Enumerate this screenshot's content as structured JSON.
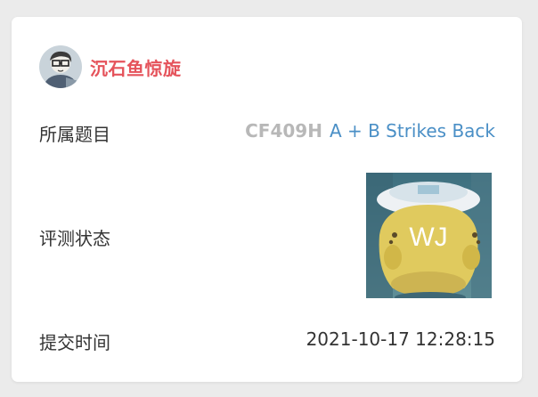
{
  "user": {
    "name": "沉石鱼惊旋"
  },
  "rows": {
    "problem_label": "所属题目",
    "problem_id": "CF409H",
    "problem_title": "A + B Strikes Back",
    "status_label": "评测状态",
    "status_text": "WJ",
    "time_label": "提交时间",
    "time_value": "2021-10-17 12:28:15"
  },
  "colors": {
    "username": "#e5535b",
    "problem_id": "#b8b8b8",
    "problem_title": "#4a8fc6",
    "card_background": "#ffffff",
    "page_background": "#ebebeb"
  },
  "icons": {
    "avatar": "user-avatar-icon",
    "status": "waiting-judge-status-image"
  }
}
